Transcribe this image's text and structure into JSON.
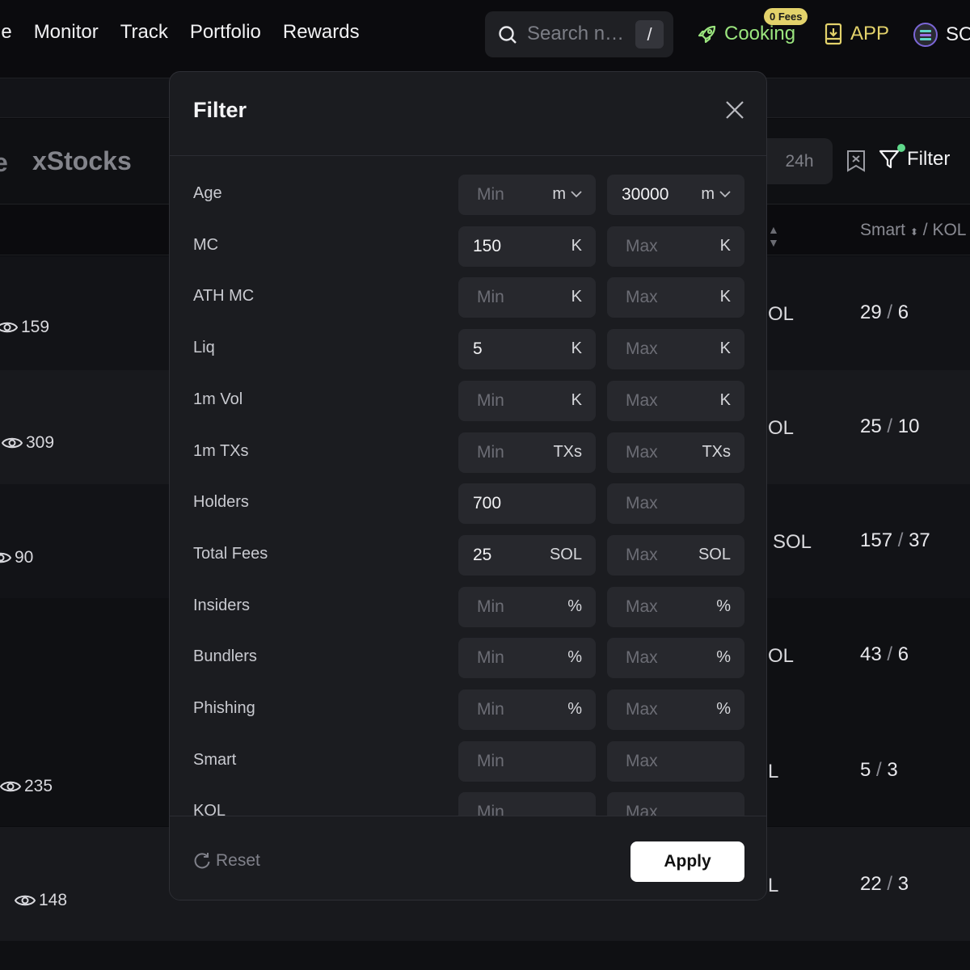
{
  "nav": {
    "links": [
      "le",
      "Monitor",
      "Track",
      "Portfolio",
      "Rewards"
    ],
    "search_placeholder": "Search n…",
    "search_shortcut": "/",
    "cooking_label": "Cooking",
    "fees_badge": "0 Fees",
    "app_label": "APP",
    "chain_label": "SO"
  },
  "categories": {
    "partial": "e",
    "xstocks": "xStocks"
  },
  "toolbar": {
    "time_range": "24h",
    "filter_label": "Filter"
  },
  "table": {
    "header_smart": "Smart",
    "header_sep": "/",
    "header_kol": "KOL",
    "rows": [
      {
        "views": "159",
        "sol": "OL",
        "smart": "29",
        "kol": "6"
      },
      {
        "views": "309",
        "sol": "OL",
        "smart": "25",
        "kol": "10"
      },
      {
        "views": "90",
        "sol": "SOL",
        "smart": "157",
        "kol": "37"
      },
      {
        "views": "",
        "sol": "OL",
        "smart": "43",
        "kol": "6"
      },
      {
        "views": "235",
        "sol": "L",
        "smart": "5",
        "kol": "3"
      },
      {
        "views": "148",
        "sol": "L",
        "smart": "22",
        "kol": "3"
      }
    ]
  },
  "filter_modal": {
    "title": "Filter",
    "rows": [
      {
        "label": "Age",
        "min": {
          "value": "",
          "placeholder": "Min",
          "unit": "m",
          "dropdown": true
        },
        "max": {
          "value": "30000",
          "placeholder": "Max",
          "unit": "m",
          "dropdown": true
        }
      },
      {
        "label": "MC",
        "min": {
          "value": "150",
          "placeholder": "Min",
          "unit": "K"
        },
        "max": {
          "value": "",
          "placeholder": "Max",
          "unit": "K"
        }
      },
      {
        "label": "ATH MC",
        "min": {
          "value": "",
          "placeholder": "Min",
          "unit": "K"
        },
        "max": {
          "value": "",
          "placeholder": "Max",
          "unit": "K"
        }
      },
      {
        "label": "Liq",
        "min": {
          "value": "5",
          "placeholder": "Min",
          "unit": "K"
        },
        "max": {
          "value": "",
          "placeholder": "Max",
          "unit": "K"
        }
      },
      {
        "label": "1m Vol",
        "min": {
          "value": "",
          "placeholder": "Min",
          "unit": "K"
        },
        "max": {
          "value": "",
          "placeholder": "Max",
          "unit": "K"
        }
      },
      {
        "label": "1m TXs",
        "min": {
          "value": "",
          "placeholder": "Min",
          "unit": "TXs"
        },
        "max": {
          "value": "",
          "placeholder": "Max",
          "unit": "TXs"
        }
      },
      {
        "label": "Holders",
        "min": {
          "value": "700",
          "placeholder": "Min",
          "unit": ""
        },
        "max": {
          "value": "",
          "placeholder": "Max",
          "unit": ""
        }
      },
      {
        "label": "Total Fees",
        "min": {
          "value": "25",
          "placeholder": "Min",
          "unit": "SOL"
        },
        "max": {
          "value": "",
          "placeholder": "Max",
          "unit": "SOL"
        }
      },
      {
        "label": "Insiders",
        "min": {
          "value": "",
          "placeholder": "Min",
          "unit": "%"
        },
        "max": {
          "value": "",
          "placeholder": "Max",
          "unit": "%"
        }
      },
      {
        "label": "Bundlers",
        "min": {
          "value": "",
          "placeholder": "Min",
          "unit": "%"
        },
        "max": {
          "value": "",
          "placeholder": "Max",
          "unit": "%"
        }
      },
      {
        "label": "Phishing",
        "min": {
          "value": "",
          "placeholder": "Min",
          "unit": "%"
        },
        "max": {
          "value": "",
          "placeholder": "Max",
          "unit": "%"
        }
      },
      {
        "label": "Smart",
        "min": {
          "value": "",
          "placeholder": "Min",
          "unit": ""
        },
        "max": {
          "value": "",
          "placeholder": "Max",
          "unit": ""
        }
      },
      {
        "label": "KOL",
        "min": {
          "value": "",
          "placeholder": "Min",
          "unit": ""
        },
        "max": {
          "value": "",
          "placeholder": "Max",
          "unit": ""
        }
      }
    ],
    "reset_label": "Reset",
    "apply_label": "Apply"
  },
  "colors": {
    "accent_green": "#9be57e",
    "accent_yellow": "#e3d26b",
    "modal_bg": "#1b1c20",
    "input_bg": "#27282d"
  }
}
